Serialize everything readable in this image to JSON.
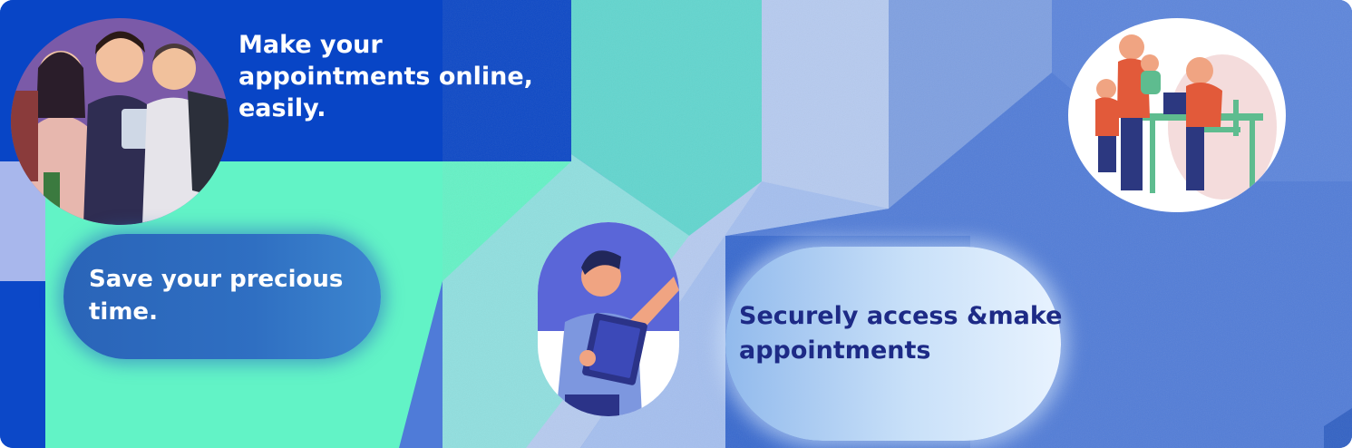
{
  "banner": {
    "headline": "Make your appointments online, easily.",
    "save_time_text": "Save your precious time.",
    "secure_text": "Securely access &make appointments"
  },
  "colors": {
    "deep_blue": "#0a44c4",
    "mint": "#63f2c6",
    "teal": "#5ed8d0",
    "periwinkle": "#4e7ad6",
    "pale_blue": "#a9c3ee",
    "navy_text": "#1d2a86"
  },
  "illustrations": [
    {
      "name": "group-of-students",
      "description_icon": "students-icon"
    },
    {
      "name": "man-with-tablet",
      "description_icon": "tablet-user-icon"
    },
    {
      "name": "family-at-laptop",
      "description_icon": "family-icon"
    }
  ]
}
